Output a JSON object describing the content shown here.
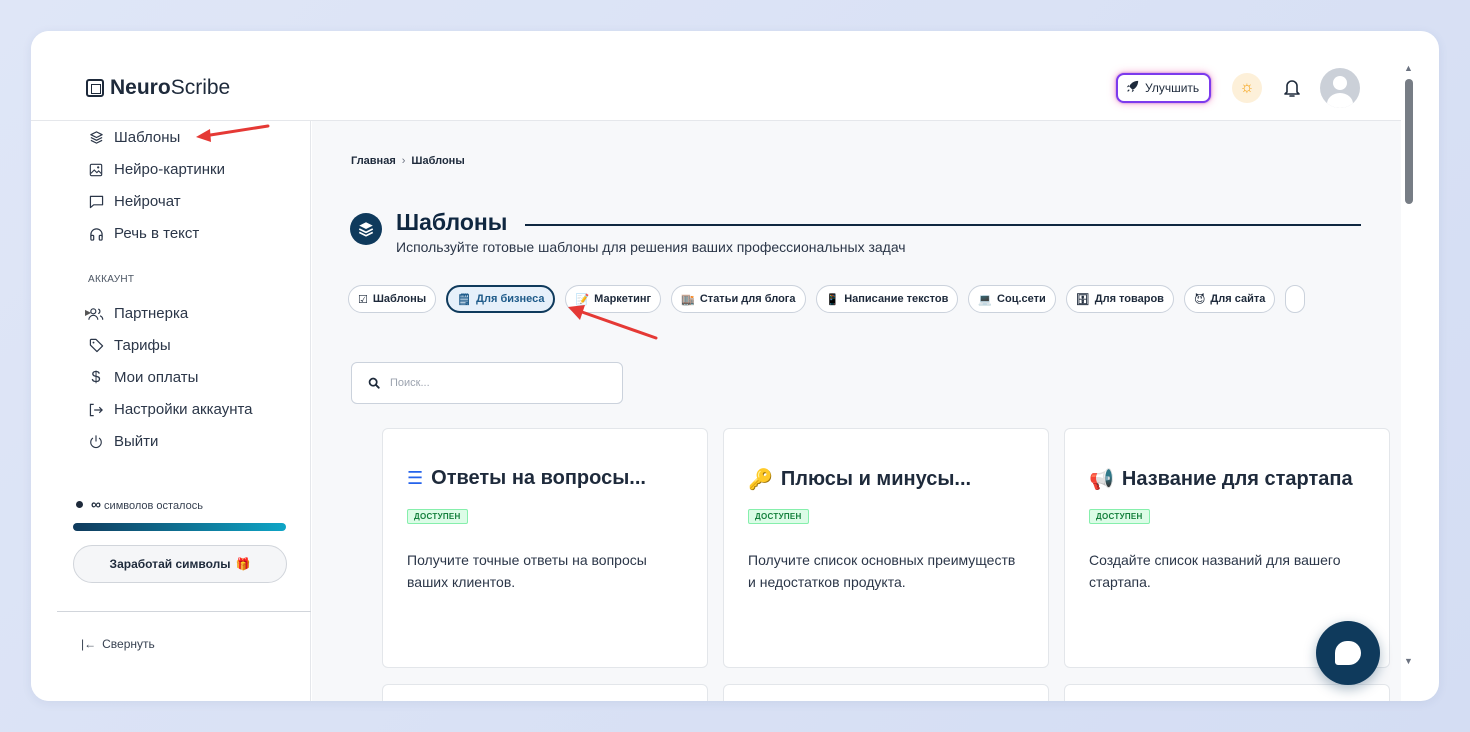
{
  "app": {
    "logo_bold": "Neuro",
    "logo_light": "Scribe"
  },
  "header": {
    "upgrade_label": "Улучшить",
    "icons": [
      "rocket-icon",
      "sun-icon",
      "bell-icon",
      "avatar"
    ]
  },
  "sidebar": {
    "items": [
      {
        "label": "Шаблоны",
        "icon": "layers-icon"
      },
      {
        "label": "Нейро-картинки",
        "icon": "image-icon"
      },
      {
        "label": "Нейрочат",
        "icon": "chat-icon"
      },
      {
        "label": "Речь в текст",
        "icon": "headphones-icon"
      }
    ],
    "section_account": "АККАУНТ",
    "account_items": [
      {
        "label": "Партнерка",
        "icon": "users-icon"
      },
      {
        "label": "Тарифы",
        "icon": "tag-icon"
      },
      {
        "label": "Мои оплаты",
        "icon": "dollar-icon"
      },
      {
        "label": "Настройки аккаунта",
        "icon": "logout-arrow-icon"
      },
      {
        "label": "Выйти",
        "icon": "power-icon"
      }
    ],
    "symbols_value": "∞",
    "symbols_text": "символов осталось",
    "symbols_progress": 1.0,
    "earn_label": "Заработай символы",
    "collapse_label": "Свернуть"
  },
  "main": {
    "breadcrumb": {
      "home": "Главная",
      "separator": "›",
      "current": "Шаблоны"
    },
    "title": "Шаблоны",
    "subtitle": "Используйте готовые шаблоны для решения ваших профессиональных задач",
    "chips": [
      {
        "label": "Шаблоны",
        "emoji": "☑",
        "active": false
      },
      {
        "label": "Для бизнеса",
        "emoji": "🗒",
        "active": true
      },
      {
        "label": "Маркетинг",
        "emoji": "📝",
        "active": false
      },
      {
        "label": "Статьи для блога",
        "emoji": "🏬",
        "active": false
      },
      {
        "label": "Написание текстов",
        "emoji": "📱",
        "active": false
      },
      {
        "label": "Соц.сети",
        "emoji": "💻",
        "active": false
      },
      {
        "label": "Для товаров",
        "emoji": "🗄",
        "active": false
      },
      {
        "label": "Для сайта",
        "emoji": "😈",
        "active": false
      }
    ],
    "search_placeholder": "Поиск...",
    "cards": [
      {
        "title": "Ответы на вопросы...",
        "icon": "list-icon",
        "emoji": "☰",
        "badge": "ДОСТУПЕН",
        "description": "Получите точные ответы на вопросы ваших клиентов."
      },
      {
        "title": "Плюсы и минусы...",
        "icon": "key-icon",
        "emoji": "🔑",
        "badge": "ДОСТУПЕН",
        "description": "Получите список основных преимуществ и недостатков продукта."
      },
      {
        "title": "Название для стартапа",
        "icon": "megaphone-icon",
        "emoji": "📢",
        "badge": "ДОСТУПЕН",
        "description": "Создайте список названий для вашего стартапа."
      }
    ]
  },
  "colors": {
    "primary": "#0f3a5c",
    "accent_arrow": "#e53935",
    "badge_green": "#15803d",
    "upgrade_border": "#7c3aed"
  }
}
